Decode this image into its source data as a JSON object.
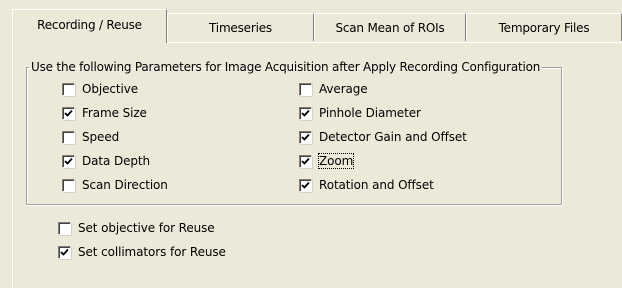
{
  "tabs": [
    {
      "label": "Recording / Reuse",
      "active": true
    },
    {
      "label": "Timeseries",
      "active": false
    },
    {
      "label": "Scan Mean of ROIs",
      "active": false
    },
    {
      "label": "Temporary Files",
      "active": false
    }
  ],
  "group": {
    "legend": "Use the following Parameters for Image Acquisition after Apply Recording Configuration",
    "left_items": [
      {
        "label": "Objective",
        "checked": false
      },
      {
        "label": "Frame Size",
        "checked": true
      },
      {
        "label": "Speed",
        "checked": false
      },
      {
        "label": "Data Depth",
        "checked": true
      },
      {
        "label": "Scan Direction",
        "checked": false
      }
    ],
    "right_items": [
      {
        "label": "Average",
        "checked": false
      },
      {
        "label": "Pinhole Diameter",
        "checked": true
      },
      {
        "label": "Detector Gain and Offset",
        "checked": true
      },
      {
        "label": "Zoom",
        "checked": true
      },
      {
        "label": "Rotation and Offset",
        "checked": true
      }
    ]
  },
  "reuse": [
    {
      "label": "Set objective for Reuse",
      "checked": false
    },
    {
      "label": "Set collimators for Reuse",
      "checked": true
    }
  ]
}
